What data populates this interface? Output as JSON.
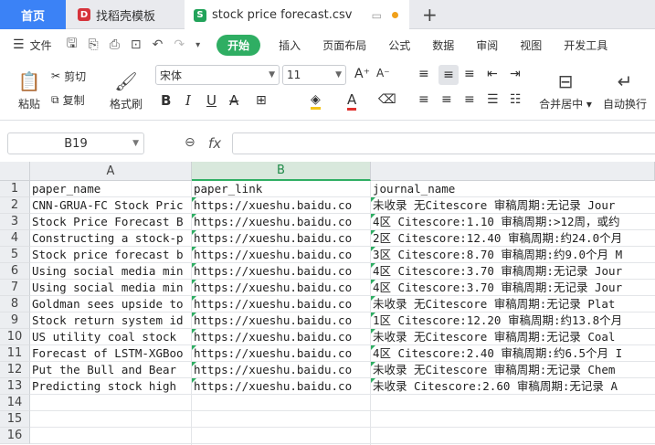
{
  "tabs": {
    "home": "首页",
    "template": "找稻壳模板",
    "file": "stock price forecast.csv"
  },
  "menu": {
    "file": "文件",
    "items": [
      "开始",
      "插入",
      "页面布局",
      "公式",
      "数据",
      "审阅",
      "视图",
      "开发工具"
    ]
  },
  "ribbon": {
    "paste": "粘贴",
    "cut": "剪切",
    "copy": "复制",
    "format_painter": "格式刷",
    "font_name": "宋体",
    "font_size": "11",
    "merge_center": "合并居中",
    "wrap_text": "自动换行"
  },
  "formula_bar": {
    "cell_ref": "B19",
    "fx": "fx",
    "value": ""
  },
  "grid": {
    "columns": [
      "A",
      "B"
    ],
    "row_numbers": [
      "1",
      "2",
      "3",
      "4",
      "5",
      "6",
      "7",
      "8",
      "9",
      "10",
      "11",
      "12",
      "13",
      "14",
      "15",
      "16"
    ],
    "rows": [
      [
        "paper_name",
        "paper_link",
        "journal_name"
      ],
      [
        "CNN-GRUA-FC Stock Pric",
        "https://xueshu.baidu.co",
        "未收录 无Citescore 审稿周期:无记录 Jour"
      ],
      [
        "Stock Price Forecast B",
        "https://xueshu.baidu.co",
        "4区 Citescore:1.10 审稿周期:>12周，或约"
      ],
      [
        "Constructing a stock-p",
        "https://xueshu.baidu.co",
        "2区 Citescore:12.40 审稿周期:约24.0个月"
      ],
      [
        "Stock price forecast b",
        "https://xueshu.baidu.co",
        "3区 Citescore:8.70 审稿周期:约9.0个月 M"
      ],
      [
        "Using social media min",
        "https://xueshu.baidu.co",
        "4区 Citescore:3.70 审稿周期:无记录 Jour"
      ],
      [
        "Using social media min",
        "https://xueshu.baidu.co",
        "4区 Citescore:3.70 审稿周期:无记录 Jour"
      ],
      [
        "Goldman sees upside to",
        "https://xueshu.baidu.co",
        "未收录 无Citescore 审稿周期:无记录 Plat"
      ],
      [
        "Stock return system id",
        "https://xueshu.baidu.co",
        "1区 Citescore:12.20 审稿周期:约13.8个月"
      ],
      [
        "US utility coal stock",
        "https://xueshu.baidu.co",
        "未收录 无Citescore 审稿周期:无记录 Coal"
      ],
      [
        "Forecast of LSTM-XGBoo",
        "https://xueshu.baidu.co",
        "4区 Citescore:2.40 审稿周期:约6.5个月 I"
      ],
      [
        "Put the Bull and Bear",
        "https://xueshu.baidu.co",
        "未收录 无Citescore 审稿周期:无记录 Chem"
      ],
      [
        "Predicting stock high",
        "https://xueshu.baidu.co",
        "未收录 Citescore:2.60 审稿周期:无记录 A"
      ],
      [
        "",
        "",
        ""
      ],
      [
        "",
        "",
        ""
      ],
      [
        "",
        "",
        ""
      ]
    ]
  }
}
